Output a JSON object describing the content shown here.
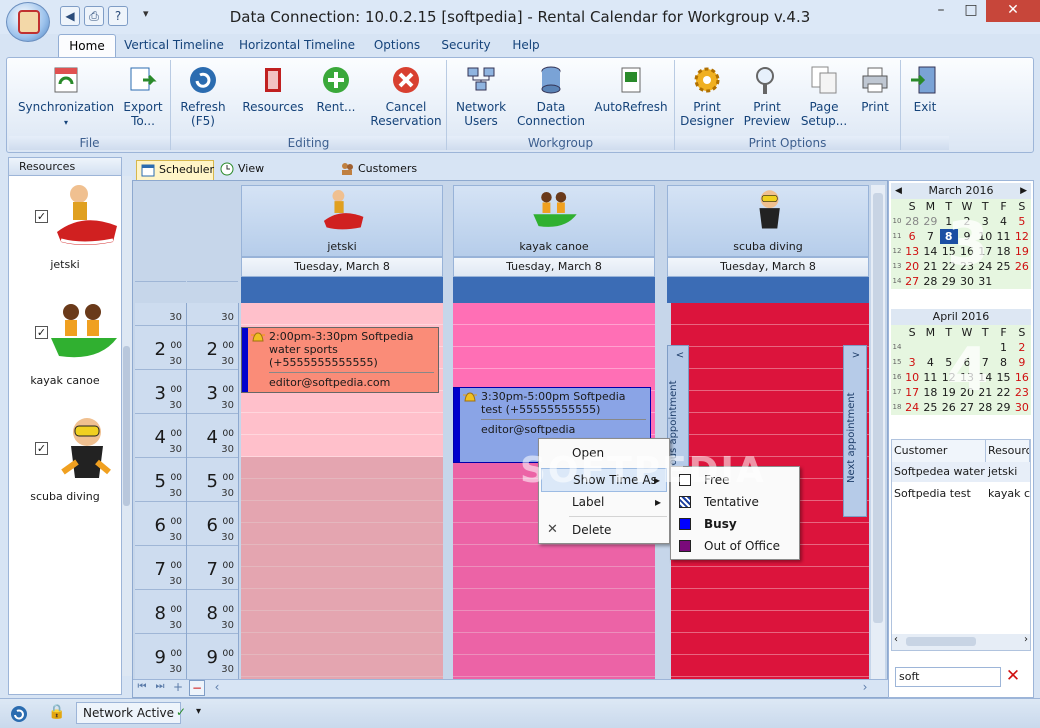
{
  "window": {
    "title": "Data Connection: 10.0.2.15 [softpedia] - Rental Calendar for Workgroup v.4.3"
  },
  "window_controls": {
    "minimize": "–",
    "maximize": "□",
    "close": "✕"
  },
  "quick_access": {
    "back": "◀",
    "print": "⎙",
    "help": "?",
    "more": "▾"
  },
  "ribbon_tabs": [
    "Home",
    "Vertical Timeline",
    "Horizontal Timeline",
    "Options",
    "Security",
    "Help"
  ],
  "ribbon": {
    "groups": {
      "file": "File",
      "editing": "Editing",
      "workgroup": "Workgroup",
      "print": "Print Options"
    },
    "buttons": {
      "sync": "Synchronization",
      "export": "Export To...",
      "refresh": "Refresh (F5)",
      "resources": "Resources",
      "rent": "Rent...",
      "cancel_reservation": "Cancel Reservation",
      "network_users": "Network Users",
      "data_connection": "Data Connection",
      "autorefresh": "AutoRefresh",
      "print_designer": "Print Designer",
      "print_preview": "Print Preview",
      "page_setup": "Page Setup...",
      "print": "Print",
      "exit": "Exit"
    }
  },
  "resources_panel": {
    "title": "Resources",
    "items": [
      {
        "name": "jetski",
        "checked": "✓"
      },
      {
        "name": "kayak canoe",
        "checked": "✓"
      },
      {
        "name": "scuba diving",
        "checked": "✓"
      }
    ]
  },
  "view_tabs": [
    "Scheduler",
    "View Reservations",
    "Customers"
  ],
  "scheduler": {
    "columns": [
      {
        "name": "jetski",
        "date": "Tuesday, March 8"
      },
      {
        "name": "kayak canoe",
        "date": "Tuesday, March 8"
      },
      {
        "name": "scuba diving",
        "date": "Tuesday, March 8"
      }
    ],
    "minute_30": "30",
    "minute_00": "00",
    "hours": [
      "2",
      "3",
      "4",
      "5",
      "6",
      "7",
      "8",
      "9"
    ],
    "appointments": [
      {
        "title": "2:00pm-3:30pm Softpedia water sports (+5555555555555)",
        "email": "editor@softpedia.com"
      },
      {
        "title": "3:30pm-5:00pm Softpedia test (+55555555555)",
        "email": "editor@softpedia"
      }
    ],
    "prev_appointment": "Previous appointment",
    "next_appointment": "Next appointment",
    "nav_glyphs": {
      "prev": "<",
      "next": ">",
      "first": "⏮",
      "fast": "⏭",
      "add": "+",
      "remove": "−",
      "left": "‹",
      "right": "›"
    }
  },
  "context_menu": {
    "items": [
      "Open",
      "Show Time As",
      "Label",
      "Delete"
    ],
    "arrow": "▸",
    "delete_glyph": "✕"
  },
  "submenu": {
    "items": [
      {
        "label": "Free",
        "swatch": "#ffffff"
      },
      {
        "label": "Tentative",
        "swatch": "#1a3ea0"
      },
      {
        "label": "Busy",
        "swatch": "#0000ff"
      },
      {
        "label": "Out of Office",
        "swatch": "#7a0a7a"
      }
    ]
  },
  "calendars": [
    {
      "month": "March 2016",
      "watermark": "3",
      "prev": "◀",
      "next": "▶",
      "days": [
        "S",
        "M",
        "T",
        "W",
        "T",
        "F",
        "S"
      ],
      "weeks": [
        [
          "10",
          "28",
          "29",
          "1",
          "2",
          "3",
          "4",
          "5"
        ],
        [
          "11",
          "6",
          "7",
          "8",
          "9",
          "10",
          "11",
          "12"
        ],
        [
          "12",
          "13",
          "14",
          "15",
          "16",
          "17",
          "18",
          "19"
        ],
        [
          "13",
          "20",
          "21",
          "22",
          "23",
          "24",
          "25",
          "26"
        ],
        [
          "14",
          "27",
          "28",
          "29",
          "30",
          "31",
          "",
          ""
        ]
      ]
    },
    {
      "month": "April 2016",
      "watermark": "4",
      "days": [
        "S",
        "M",
        "T",
        "W",
        "T",
        "F",
        "S"
      ],
      "weeks": [
        [
          "14",
          "",
          "",
          "",
          "",
          "",
          "1",
          "2"
        ],
        [
          "15",
          "3",
          "4",
          "5",
          "6",
          "7",
          "8",
          "9"
        ],
        [
          "16",
          "10",
          "11",
          "12",
          "13",
          "14",
          "15",
          "16"
        ],
        [
          "17",
          "17",
          "18",
          "19",
          "20",
          "21",
          "22",
          "23"
        ],
        [
          "18",
          "24",
          "25",
          "26",
          "27",
          "28",
          "29",
          "30"
        ]
      ]
    }
  ],
  "customers_grid": {
    "headers": [
      "Customer",
      "Resource"
    ],
    "rows": [
      [
        "Softpedea water sp",
        "jetski"
      ],
      [
        "Softpedia test",
        "kayak ca"
      ]
    ]
  },
  "search": {
    "value": "soft",
    "clear": "✕"
  },
  "status": {
    "network": "Network Active",
    "lock": "🔒",
    "shield": "✓",
    "dropdown": "▾"
  },
  "watermark": "SOFTPEDIA",
  "colors": {
    "jetski": "#ffb6c1",
    "kayak": "#ff69b4",
    "scuba": "#dc143c",
    "busy": "#3b6cb5"
  }
}
